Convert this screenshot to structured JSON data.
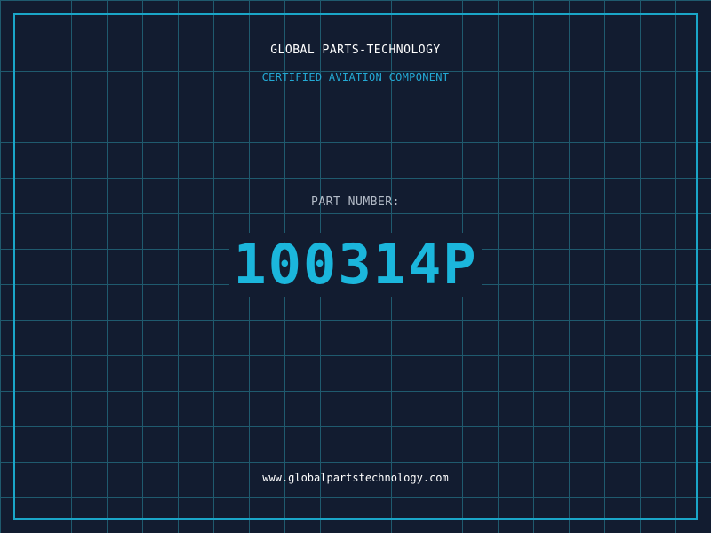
{
  "header": {
    "brand": "GLOBAL PARTS-TECHNOLOGY",
    "subtitle": "CERTIFIED AVIATION COMPONENT"
  },
  "part": {
    "label": "PART NUMBER:",
    "number": "100314P"
  },
  "footer": {
    "url": "www.globalpartstechnology.com"
  },
  "colors": {
    "background": "#121c30",
    "grid": "#1f5a6e",
    "accent": "#1bb6dc",
    "frame": "#1aa6c8"
  }
}
